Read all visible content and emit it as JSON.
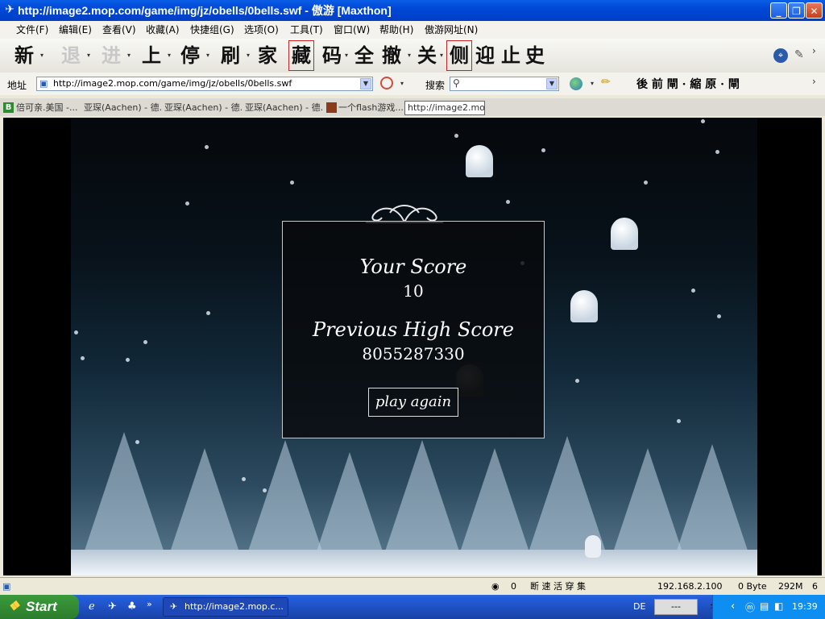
{
  "window": {
    "title": "http://image2.mop.com/game/img/jz/obells/0bells.swf - 傲游 [Maxthon]",
    "buttons": [
      "_",
      "❐",
      "✕"
    ]
  },
  "menu": [
    "文件(F)",
    "编辑(E)",
    "查看(V)",
    "收藏(A)",
    "快捷组(G)",
    "选项(O)",
    "工具(T)",
    "窗口(W)",
    "帮助(H)",
    "傲游网址(N)"
  ],
  "toolbar": {
    "buttons": [
      "新",
      "退",
      "进",
      "上",
      "停",
      "刷",
      "家",
      "藏",
      "码",
      "全",
      "撤",
      "关",
      "侧",
      "迎",
      "止",
      "史"
    ]
  },
  "address": {
    "label": "地址",
    "url": "http://image2.mop.com/game/img/jz/obells/0bells.swf",
    "search_label": "搜索",
    "right_tools": "後 前 閘 · 縮 原 · 閘"
  },
  "tabs": [
    {
      "label": "倍可亲.美国 -..."
    },
    {
      "label": "亚琛(Aachen) - 德..."
    },
    {
      "label": "亚琛(Aachen) - 德..."
    },
    {
      "label": "亚琛(Aachen) - 德..."
    },
    {
      "label": "一个flash游戏..."
    },
    {
      "label": "http://image2.mop..."
    }
  ],
  "game": {
    "your_score_label": "Your Score",
    "your_score": "10",
    "high_score_label": "Previous High Score",
    "high_score": "8055287330",
    "play_again": "play again"
  },
  "status": {
    "count": "0",
    "ip": "192.168.2.100",
    "bytes": "0 Byte",
    "memory": "292M",
    "tabs_count": "6"
  },
  "taskbar": {
    "start": "Start",
    "task": "http://image2.mop.c...",
    "lang": "DE",
    "tray_box": "---",
    "clock": "19:39"
  }
}
